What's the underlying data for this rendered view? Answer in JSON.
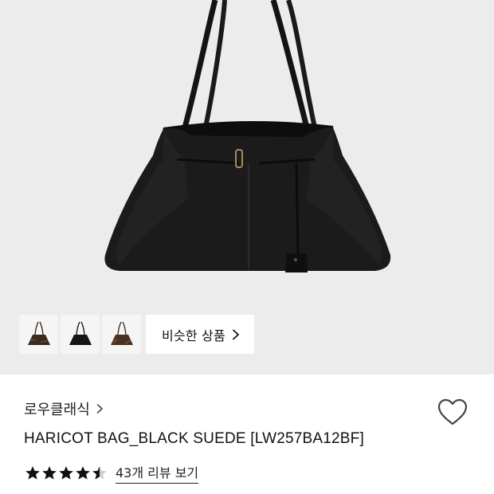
{
  "gallery": {
    "main_image": "black-suede-tote-bag-image",
    "background_color": "#ececec",
    "thumbnails": [
      {
        "name": "brown-variant-thumbnail",
        "color": "#3b2a1e"
      },
      {
        "name": "black-variant-thumbnail",
        "color": "#151515"
      },
      {
        "name": "dark-brown-variant-thumbnail",
        "color": "#4a3020"
      }
    ],
    "similar_button_label": "비슷한 상품"
  },
  "product": {
    "brand": "로우클래식",
    "title": "HARICOT BAG_BLACK SUEDE [LW257BA12BF]",
    "rating": 4.5,
    "rating_max": 5,
    "review_link": "43개 리뷰 보기"
  },
  "icons": {
    "brand_chevron": "chevron-right-icon",
    "wishlist": "heart-outline-icon",
    "similar_chevron": "chevron-right-icon",
    "star": "star-icon"
  },
  "colors": {
    "star": "#111111",
    "text": "#111111"
  }
}
